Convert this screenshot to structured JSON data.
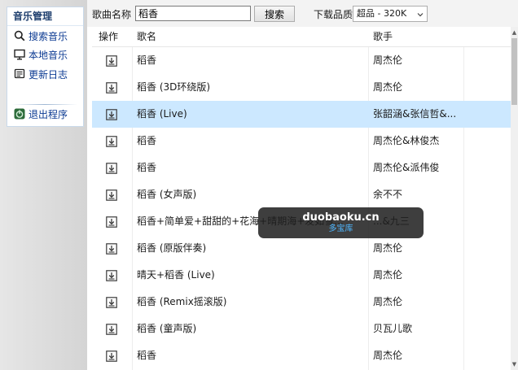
{
  "sidebar": {
    "title": "音乐管理",
    "items": [
      {
        "label": "搜索音乐",
        "icon": "search-icon"
      },
      {
        "label": "本地音乐",
        "icon": "monitor-icon"
      },
      {
        "label": "更新日志",
        "icon": "notes-icon"
      },
      {
        "label": "退出程序",
        "icon": "exit-icon"
      }
    ]
  },
  "search": {
    "label": "歌曲名称",
    "value": "稻香",
    "button": "搜索",
    "quality_label": "下载品质",
    "quality_value": "超品 - 320K"
  },
  "table": {
    "headers": {
      "action": "操作",
      "title": "歌名",
      "artist": "歌手"
    },
    "rows": [
      {
        "title": "稻香",
        "artist": "周杰伦",
        "selected": false
      },
      {
        "title": "稻香 (3D环绕版)",
        "artist": "周杰伦",
        "selected": false
      },
      {
        "title": "稻香 (Live)",
        "artist": "张韶涵&张信哲&...",
        "selected": true
      },
      {
        "title": "稻香",
        "artist": "周杰伦&林俊杰",
        "selected": false
      },
      {
        "title": "稻香",
        "artist": "周杰伦&派伟俊",
        "selected": false
      },
      {
        "title": "稻香 (女声版)",
        "artist": "余不不",
        "selected": false
      },
      {
        "title": "稻香+简单爱+甜甜的+花海+晴期海+发如雪...",
        "artist": "...&九三",
        "selected": false
      },
      {
        "title": "稻香 (原版伴奏)",
        "artist": "周杰伦",
        "selected": false
      },
      {
        "title": "晴天+稻香 (Live)",
        "artist": "周杰伦",
        "selected": false
      },
      {
        "title": "稻香 (Remix摇滚版)",
        "artist": "周杰伦",
        "selected": false
      },
      {
        "title": "稻香 (童声版)",
        "artist": "贝瓦儿歌",
        "selected": false
      },
      {
        "title": "稻香",
        "artist": "周杰伦",
        "selected": false
      }
    ]
  },
  "watermark": {
    "line1": "duobaoku.cn",
    "line2": "多宝库"
  },
  "colors": {
    "selected_row": "#cce8ff",
    "nav_link": "#0b3a92",
    "nav_title": "#1f3f6e"
  }
}
